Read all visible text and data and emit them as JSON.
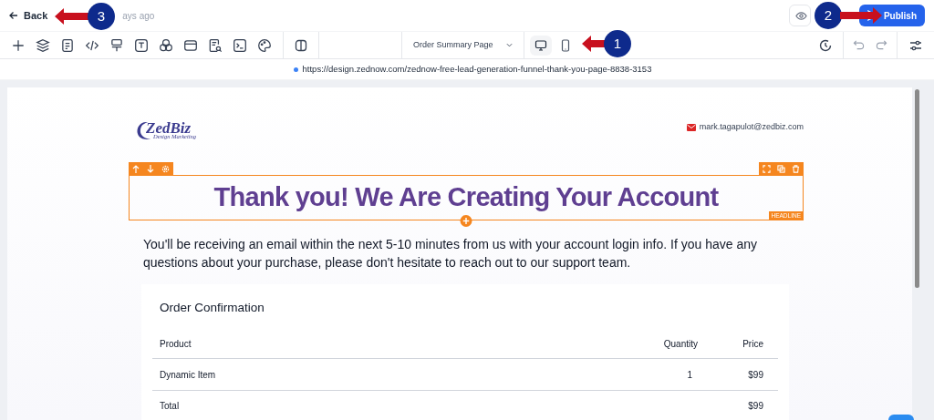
{
  "topbar": {
    "back": "Back",
    "saved_text": "ays ago",
    "publish": "Publish"
  },
  "toolbar": {
    "page_select": "Order Summary Page",
    "devices": [
      {
        "kind": "desktop",
        "selected": true
      },
      {
        "kind": "mobile",
        "selected": false
      }
    ]
  },
  "url": "https://design.zednow.com/zednow-free-lead-generation-funnel-thank-you-page-8838-3153",
  "page": {
    "logo": {
      "name": "ZedBiz",
      "tagline": "Design Marketing"
    },
    "email": "mark.tagapulot@zedbiz.com",
    "headline": "Thank you! We Are Creating Your Account",
    "element_tag": "HEADLINE",
    "paragraph": "You'll be receiving an email within the next 5-10 minutes from us with your account login info. If you have any questions about your purchase, please don't hesitate to reach out to our support team.",
    "order": {
      "title": "Order Confirmation",
      "columns": [
        "Product",
        "Quantity",
        "Price"
      ],
      "rows": [
        [
          "Dynamic Item",
          "1",
          "$99"
        ]
      ],
      "total": {
        "label": "Total",
        "value": "$99"
      }
    }
  },
  "annotations": [
    {
      "number": "3"
    },
    {
      "number": "2"
    },
    {
      "number": "1"
    }
  ]
}
